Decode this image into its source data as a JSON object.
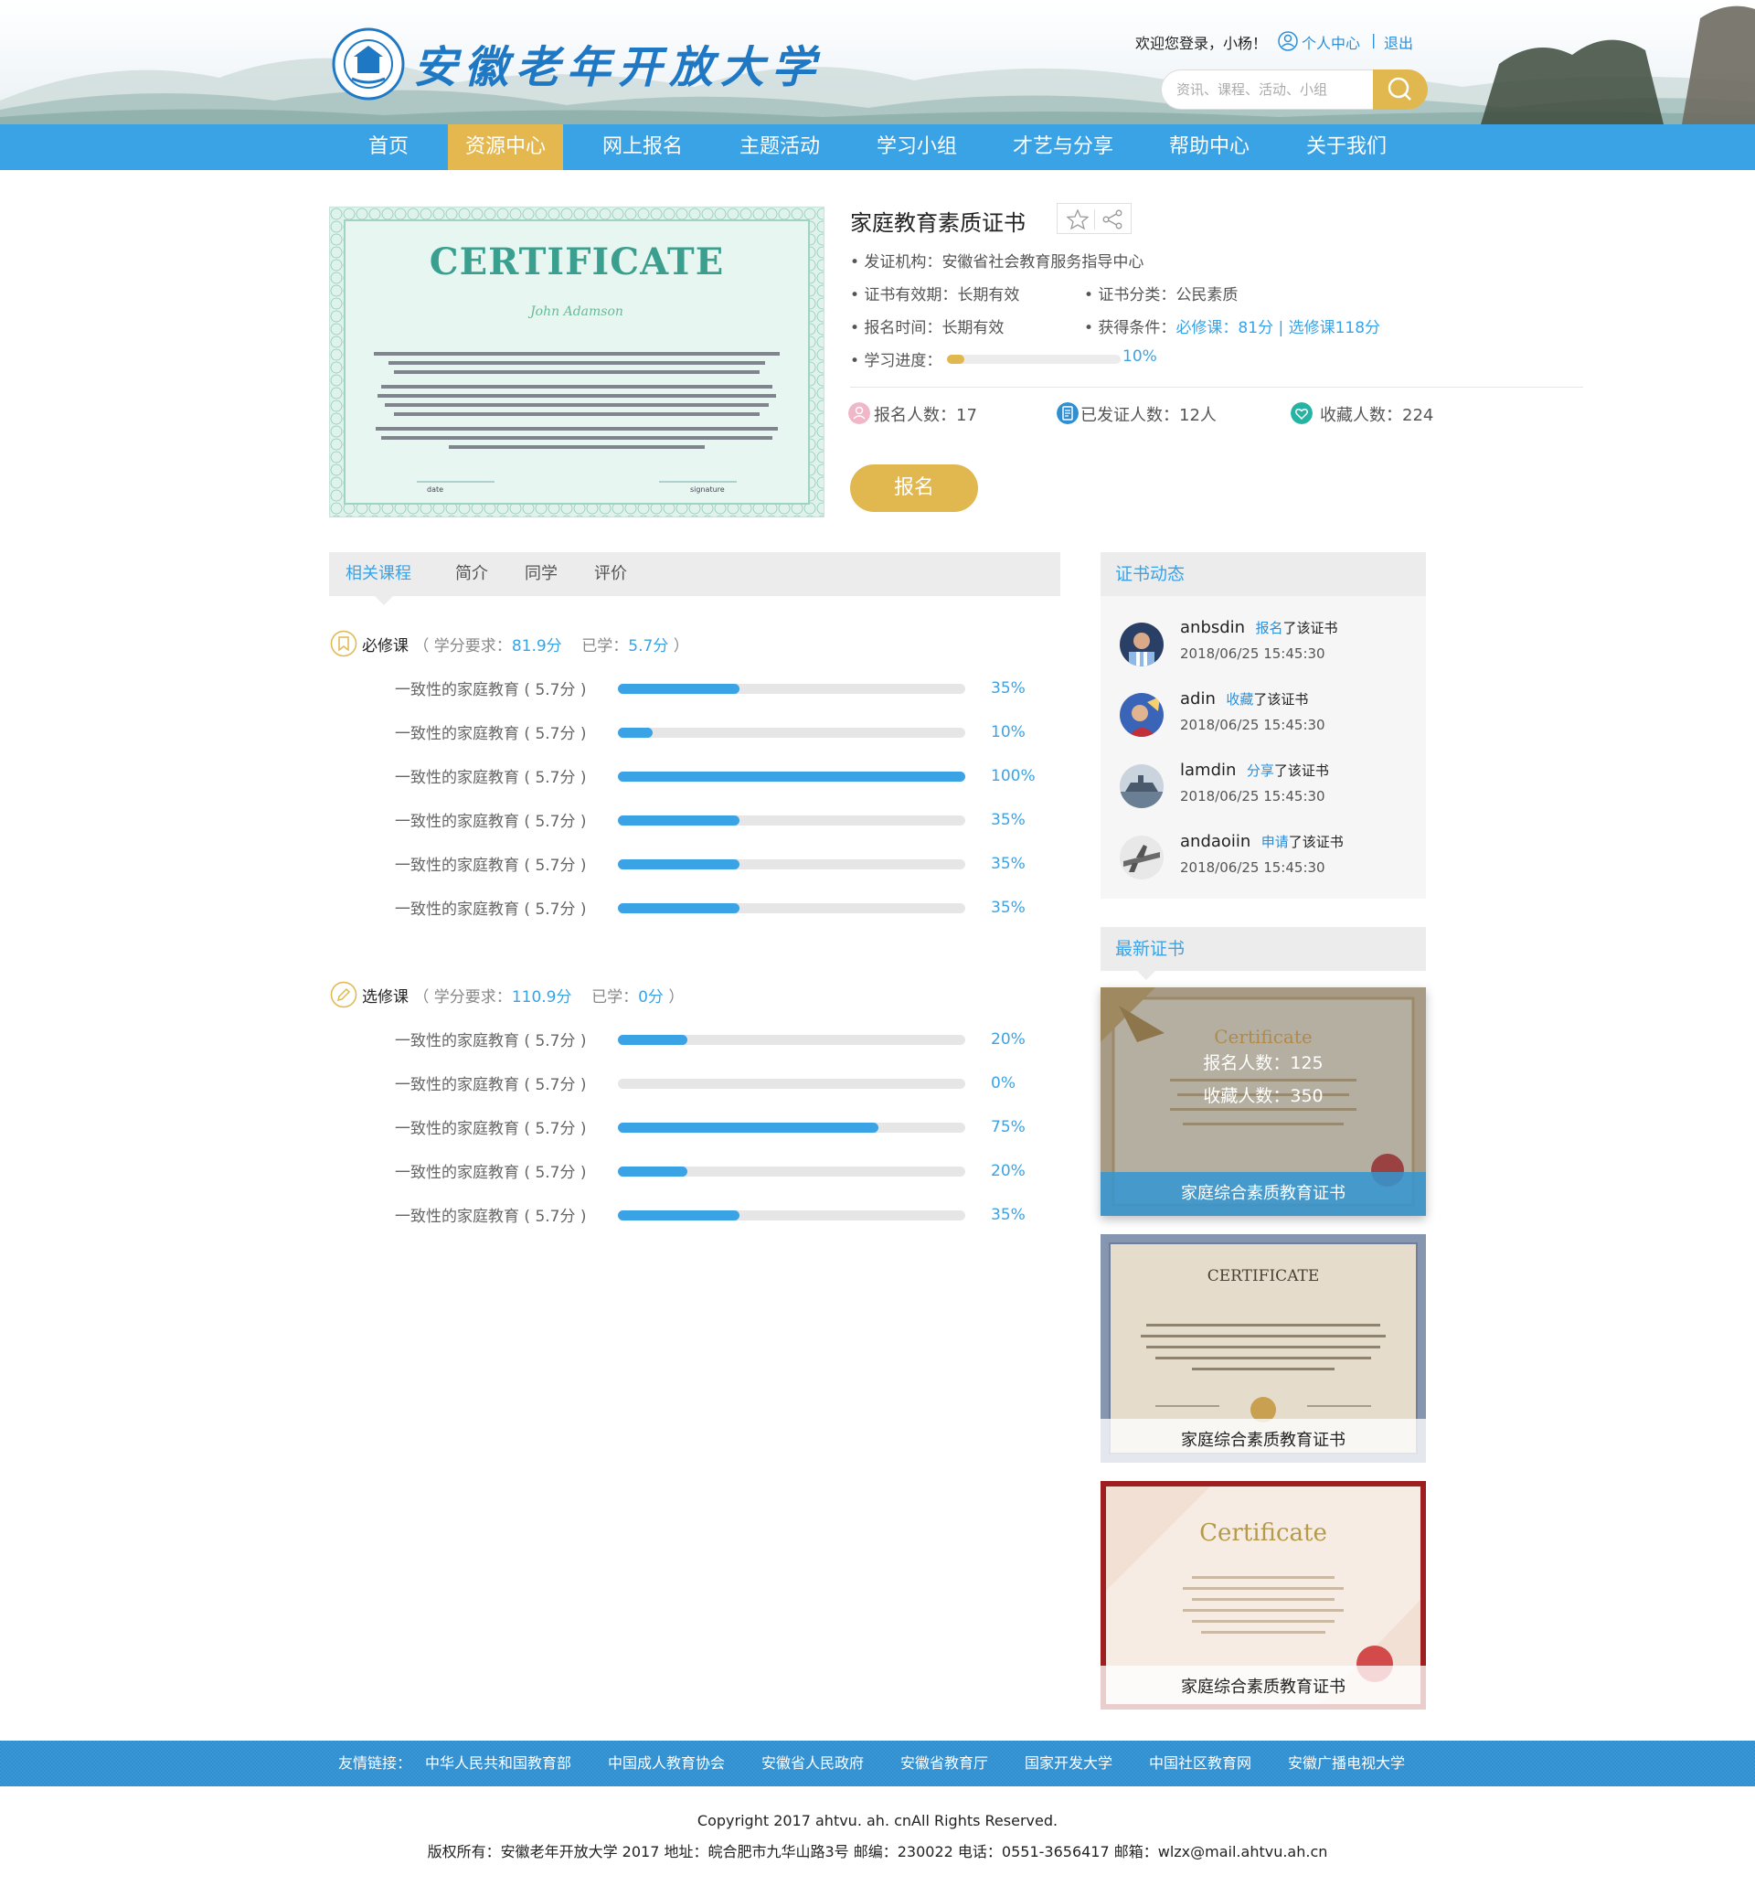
{
  "header": {
    "site_title": "安徽老年开放大学",
    "welcome": "欢迎您登录，小杨！",
    "personal_center": "个人中心",
    "separator": "|",
    "logout": "退出",
    "search_placeholder": "资讯、课程、活动、小组"
  },
  "nav": {
    "items": [
      {
        "label": "首页"
      },
      {
        "label": "资源中心"
      },
      {
        "label": "网上报名"
      },
      {
        "label": "主题活动"
      },
      {
        "label": "学习小组"
      },
      {
        "label": "才艺与分享"
      },
      {
        "label": "帮助中心"
      },
      {
        "label": "关于我们"
      }
    ],
    "active_index": 1
  },
  "certificate": {
    "image_heading": "CERTIFICATE",
    "image_name": "John Adamson",
    "image_date_label": "date",
    "image_signature_label": "signature",
    "title": "家庭教育素质证书",
    "issuer_label": "• 发证机构：",
    "issuer": "安徽省社会教育服务指导中心",
    "validity_label": "• 证书有效期：",
    "validity": "长期有效",
    "category_label": "• 证书分类：",
    "category": "公民素质",
    "signup_time_label": "• 报名时间：",
    "signup_time": "长期有效",
    "condition_label": "• 获得条件：",
    "condition": "必修课：81分 | 选修课118分",
    "progress_label": "• 学习进度：",
    "progress_value": 10,
    "progress_text": "10%",
    "stats": {
      "signup": "报名人数：17",
      "issued": "已发证人数：12人",
      "favorites": "收藏人数：224"
    },
    "signup_button": "报名"
  },
  "tabs": [
    {
      "label": "相关课程"
    },
    {
      "label": "简介"
    },
    {
      "label": "同学"
    },
    {
      "label": "评价"
    }
  ],
  "required": {
    "title": "必修课",
    "req_prefix": "（ 学分要求：",
    "req_value": "81.9分",
    "learned_prefix": "已学：",
    "learned_value": "5.7分",
    "suffix": "）",
    "courses": [
      {
        "name": "一致性的家庭教育 ( 5.7分 )",
        "progress": 35,
        "pct": "35%"
      },
      {
        "name": "一致性的家庭教育 ( 5.7分 )",
        "progress": 10,
        "pct": "10%"
      },
      {
        "name": "一致性的家庭教育 ( 5.7分 )",
        "progress": 100,
        "pct": "100%"
      },
      {
        "name": "一致性的家庭教育 ( 5.7分 )",
        "progress": 35,
        "pct": "35%"
      },
      {
        "name": "一致性的家庭教育 ( 5.7分 )",
        "progress": 35,
        "pct": "35%"
      },
      {
        "name": "一致性的家庭教育 ( 5.7分 )",
        "progress": 35,
        "pct": "35%"
      }
    ]
  },
  "elective": {
    "title": "选修课",
    "req_prefix": "（ 学分要求：",
    "req_value": "110.9分",
    "learned_prefix": "已学：",
    "learned_value": "0分",
    "suffix": "）",
    "courses": [
      {
        "name": "一致性的家庭教育 ( 5.7分 )",
        "progress": 20,
        "pct": "20%"
      },
      {
        "name": "一致性的家庭教育 ( 5.7分 )",
        "progress": 0,
        "pct": "0%"
      },
      {
        "name": "一致性的家庭教育 ( 5.7分 )",
        "progress": 75,
        "pct": "75%"
      },
      {
        "name": "一致性的家庭教育 ( 5.7分 )",
        "progress": 20,
        "pct": "20%"
      },
      {
        "name": "一致性的家庭教育 ( 5.7分 )",
        "progress": 35,
        "pct": "35%"
      }
    ]
  },
  "dynamics": {
    "title": "证书动态",
    "items": [
      {
        "user": "anbsdin",
        "action": "报名",
        "suffix": "了该证书",
        "time": "2018/06/25  15:45:30"
      },
      {
        "user": "adin",
        "action": "收藏",
        "suffix": "了该证书",
        "time": "2018/06/25  15:45:30"
      },
      {
        "user": "lamdin",
        "action": "分享",
        "suffix": "了该证书",
        "time": "2018/06/25  15:45:30"
      },
      {
        "user": "andaoiin",
        "action": "申请",
        "suffix": "了该证书",
        "time": "2018/06/25  15:45:30"
      }
    ]
  },
  "latest": {
    "title": "最新证书",
    "items": [
      {
        "name": "家庭综合素质教育证书",
        "heading": "Certificate",
        "signup": "报名人数：125",
        "favorites": "收藏人数：350"
      },
      {
        "name": "家庭综合素质教育证书",
        "heading": "CERTIFICATE"
      },
      {
        "name": "家庭综合素质教育证书",
        "heading": "Certificate"
      }
    ]
  },
  "footer": {
    "links_label": "友情链接：",
    "links": [
      "中华人民共和国教育部",
      "中国成人教育协会",
      "安徽省人民政府",
      "安徽省教育厅",
      "国家开发大学",
      "中国社区教育网",
      "安徽广播电视大学"
    ],
    "copyright": "Copyright 2017 ahtvu. ah. cnAll Rights Reserved.",
    "info": "版权所有：安徽老年开放大学 2017 地址：皖合肥市九华山路3号 邮编：230022 电话：0551-3656417 邮箱：wlzx@mail.ahtvu.ah.cn"
  },
  "colors": {
    "primary_blue": "#3aa3e6",
    "gold": "#e0b84f",
    "footer_blue": "#2f8fd1"
  }
}
